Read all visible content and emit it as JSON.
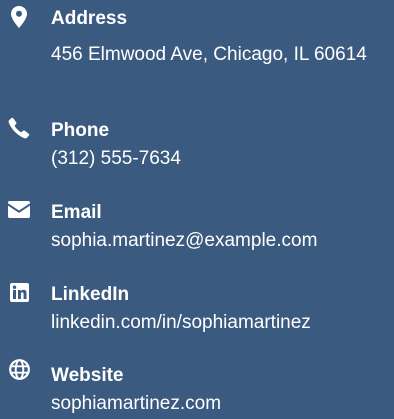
{
  "contacts": [
    {
      "icon": "map-marker-icon",
      "label": "Address",
      "value": "456 Elmwood Ave, Chicago, IL 60614"
    },
    {
      "icon": "phone-icon",
      "label": "Phone",
      "value": "(312) 555-7634"
    },
    {
      "icon": "envelope-icon",
      "label": "Email",
      "value": "sophia.martinez@example.com"
    },
    {
      "icon": "linkedin-icon",
      "label": "LinkedIn",
      "value": "linkedin.com/in/sophiamartinez"
    },
    {
      "icon": "globe-icon",
      "label": "Website",
      "value": "sophiamartinez.com"
    }
  ],
  "colors": {
    "background": "#3b5a80",
    "text": "#ffffff"
  }
}
